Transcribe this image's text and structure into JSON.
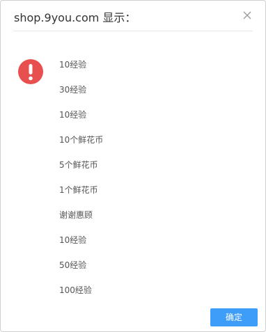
{
  "dialog": {
    "title": "shop.9you.com 显示：",
    "close_icon": "close-icon",
    "alert_icon": "exclamation-icon",
    "alert_color": "#e84f4f",
    "accent_color": "#3d9df8",
    "messages": [
      "10经验",
      "30经验",
      "10经验",
      "10个鲜花币",
      "5个鲜花币",
      "1个鲜花币",
      "谢谢惠顾",
      "10经验",
      "50经验",
      "100经验"
    ],
    "ok_label": "确定"
  }
}
